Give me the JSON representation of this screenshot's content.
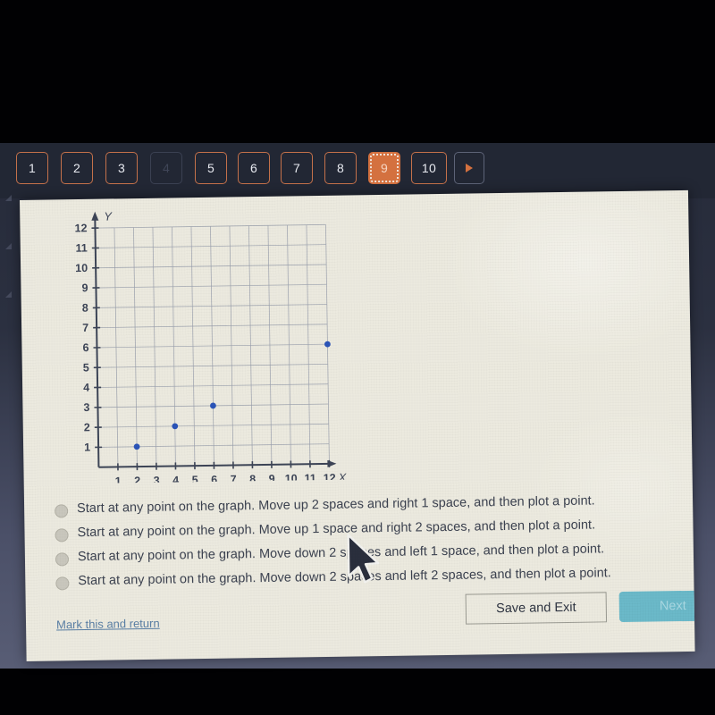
{
  "nav": {
    "buttons": [
      {
        "label": "1",
        "state": "normal"
      },
      {
        "label": "2",
        "state": "normal"
      },
      {
        "label": "3",
        "state": "normal"
      },
      {
        "label": "4",
        "state": "disabled"
      },
      {
        "label": "5",
        "state": "normal"
      },
      {
        "label": "6",
        "state": "normal"
      },
      {
        "label": "7",
        "state": "normal"
      },
      {
        "label": "8",
        "state": "normal"
      },
      {
        "label": "9",
        "state": "active"
      },
      {
        "label": "10",
        "state": "normal"
      }
    ],
    "next_arrow_icon": "triangle-right-icon",
    "active_color": "#d4713f",
    "border_color": "#c4714a"
  },
  "chart_data": {
    "type": "scatter",
    "title": "",
    "xlabel": "X",
    "ylabel": "Y",
    "xlim": [
      0,
      12
    ],
    "ylim": [
      0,
      12
    ],
    "xticks": [
      1,
      2,
      3,
      4,
      5,
      6,
      7,
      8,
      9,
      10,
      11,
      12
    ],
    "yticks": [
      1,
      2,
      3,
      4,
      5,
      6,
      7,
      8,
      9,
      10,
      11,
      12
    ],
    "grid": true,
    "point_color": "#2b54b8",
    "axis_color": "#3d4557",
    "grid_color": "#9aa0ad",
    "points": [
      {
        "x": 2,
        "y": 1
      },
      {
        "x": 4,
        "y": 2
      },
      {
        "x": 6,
        "y": 3
      },
      {
        "x": 12,
        "y": 6
      }
    ]
  },
  "options": [
    {
      "text": "Start at any point on the graph. Move up 2 spaces and right 1 space, and then plot a point.",
      "selected": false
    },
    {
      "text": "Start at any point on the graph. Move up 1 space and right 2 spaces, and then plot a point.",
      "selected": false
    },
    {
      "text": "Start at any point on the graph. Move down 2 spaces and left 1 space, and then plot a point.",
      "selected": false
    },
    {
      "text": "Start at any point on the graph. Move down 2 spaces and left 2 spaces, and then plot a point.",
      "selected": false
    }
  ],
  "footer": {
    "mark_link": "Mark this and return",
    "save_label": "Save and Exit",
    "next_label": "Next",
    "next_color": "#6bb9c9"
  },
  "cursor": {
    "icon": "arrow-pointer-icon"
  }
}
